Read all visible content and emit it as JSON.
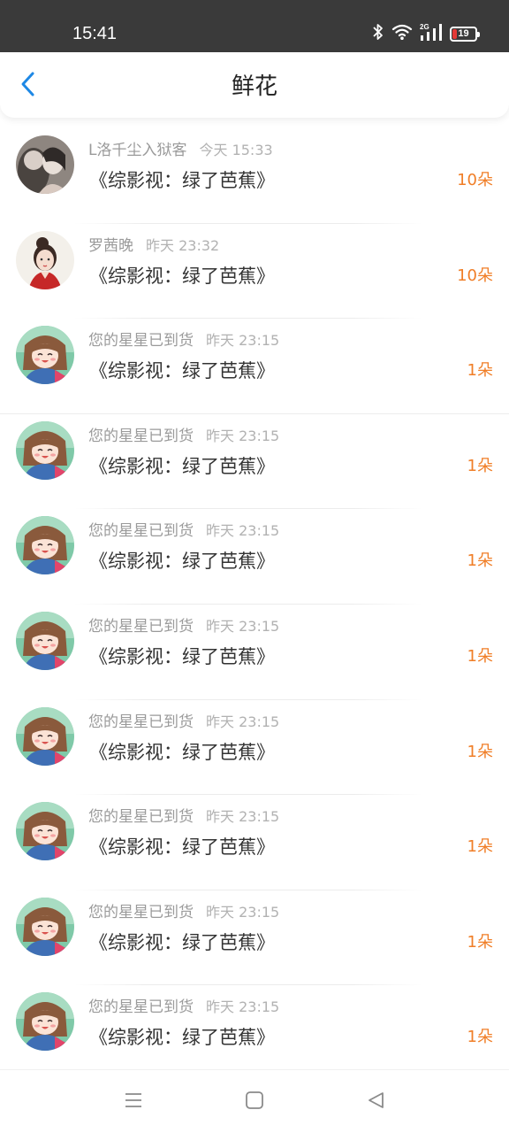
{
  "status_bar": {
    "time": "15:41",
    "battery": "19",
    "icons": [
      "bluetooth-icon",
      "wifi-icon",
      "signal-icon",
      "battery-icon"
    ]
  },
  "header": {
    "title": "鲜花",
    "back_icon": "chevron-left-icon"
  },
  "colors": {
    "accent": "#1e88e5",
    "count": "#f07e27",
    "status_bar_bg": "#3a3a3a",
    "battery_low": "#e53935"
  },
  "gifts": [
    {
      "user": "L洛千尘入狱客",
      "time": "今天 15:33",
      "book": "《综影视：绿了芭蕉》",
      "count": "10朵",
      "avatar": "avatar-dark"
    },
    {
      "user": "罗茜晚",
      "time": "昨天 23:32",
      "book": "《综影视：绿了芭蕉》",
      "count": "10朵",
      "avatar": "avatar-girl-red"
    },
    {
      "user": "您的星星已到货",
      "time": "昨天 23:15",
      "book": "《综影视：绿了芭蕉》",
      "count": "1朵",
      "avatar": "avatar-anime"
    },
    {
      "user": "您的星星已到货",
      "time": "昨天 23:15",
      "book": "《综影视：绿了芭蕉》",
      "count": "1朵",
      "avatar": "avatar-anime"
    },
    {
      "user": "您的星星已到货",
      "time": "昨天 23:15",
      "book": "《综影视：绿了芭蕉》",
      "count": "1朵",
      "avatar": "avatar-anime"
    },
    {
      "user": "您的星星已到货",
      "time": "昨天 23:15",
      "book": "《综影视：绿了芭蕉》",
      "count": "1朵",
      "avatar": "avatar-anime"
    },
    {
      "user": "您的星星已到货",
      "time": "昨天 23:15",
      "book": "《综影视：绿了芭蕉》",
      "count": "1朵",
      "avatar": "avatar-anime"
    },
    {
      "user": "您的星星已到货",
      "time": "昨天 23:15",
      "book": "《综影视：绿了芭蕉》",
      "count": "1朵",
      "avatar": "avatar-anime"
    },
    {
      "user": "您的星星已到货",
      "time": "昨天 23:15",
      "book": "《综影视：绿了芭蕉》",
      "count": "1朵",
      "avatar": "avatar-anime"
    },
    {
      "user": "您的星星已到货",
      "time": "昨天 23:15",
      "book": "《综影视：绿了芭蕉》",
      "count": "1朵",
      "avatar": "avatar-anime"
    }
  ],
  "nav_bar": {
    "buttons": [
      "menu-icon",
      "home-icon",
      "back-triangle-icon"
    ]
  }
}
